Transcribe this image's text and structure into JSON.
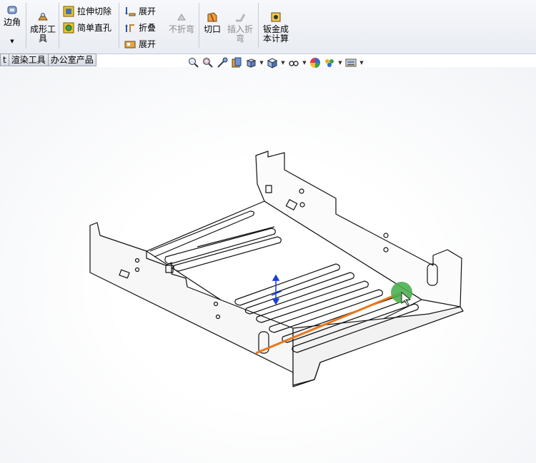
{
  "toolbar": {
    "corner_label": "边角",
    "forming_tool_label": "成形工\n具",
    "extruded_cut_label": "拉伸切除",
    "simple_hole_label": "简单直孔",
    "unfold_label": "展开",
    "fold_label": "折叠",
    "flatten_label": "展开",
    "no_bends_label": "不折弯",
    "rip_label": "切口",
    "insert_bends_label": "插入折\n弯",
    "sheet_metal_cost_label": "钣金成\n本计算"
  },
  "tabs": [
    {
      "label": "t"
    },
    {
      "label": "渲染工具"
    },
    {
      "label": "办公室产品"
    }
  ],
  "view_toolbar": {
    "icons": [
      "zoom-to-fit-icon",
      "zoom-to-area-icon",
      "previous-view-icon",
      "section-view-icon",
      "view-orientation-icon",
      "display-style-icon",
      "hide-show-items-icon",
      "edit-appearance-icon",
      "apply-scene-icon",
      "view-settings-icon"
    ]
  },
  "colors": {
    "accent_line": "#e8771c",
    "cursor_highlight": "#4caf50",
    "triad_blue": "#1a3fd6"
  }
}
